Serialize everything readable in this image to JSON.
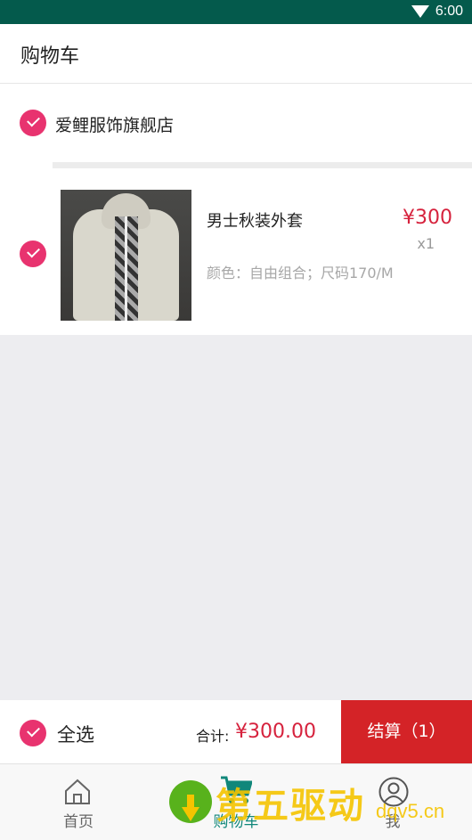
{
  "status_bar": {
    "time": "6:00"
  },
  "header": {
    "title": "购物车"
  },
  "store": {
    "name": "爱鲤服饰旗舰店",
    "checked": true,
    "items": [
      {
        "name": "男士秋装外套",
        "attrs": "颜色：自由组合；尺码170/M",
        "price": "¥300",
        "qty": "x1",
        "checked": true
      }
    ]
  },
  "bottom_bar": {
    "select_all": "全选",
    "total_label": "合计:",
    "total_value": "¥300.00",
    "checkout_label": "结算（1）"
  },
  "tabs": [
    {
      "label": "首页",
      "icon": "home-icon",
      "active": false
    },
    {
      "label": "购物车",
      "icon": "cart-icon",
      "active": true
    },
    {
      "label": "我",
      "icon": "user-icon",
      "active": false
    }
  ],
  "watermark": {
    "text": "第五驱动",
    "site": "dqv5.cn"
  },
  "colors": {
    "accent_pink": "#e8336f",
    "price_red": "#d6223d",
    "checkout_red": "#d42327",
    "status_bar": "#045a4c",
    "tab_active": "#10877a"
  }
}
